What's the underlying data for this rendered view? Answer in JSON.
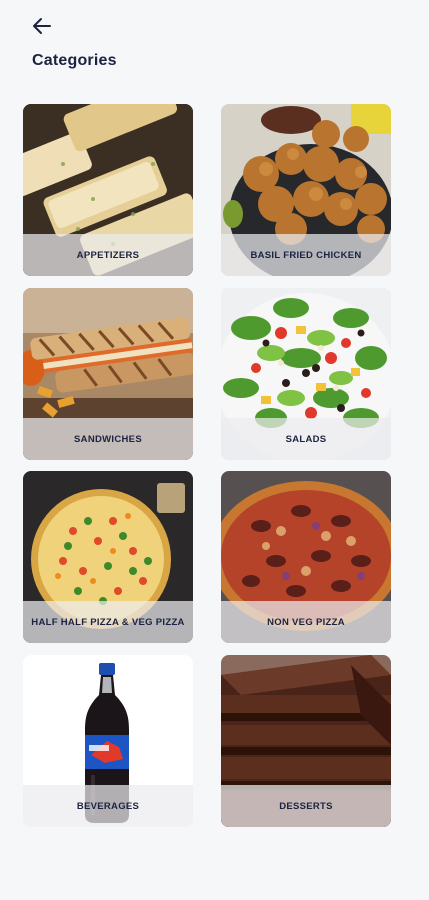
{
  "header": {
    "title": "Categories",
    "back_icon": "arrow-left-icon"
  },
  "categories": [
    {
      "label": "APPETIZERS"
    },
    {
      "label": "BASIL FRIED CHICKEN"
    },
    {
      "label": "SANDWICHES"
    },
    {
      "label": "SALADS"
    },
    {
      "label": "HALF HALF PIZZA & VEG PIZZA"
    },
    {
      "label": "NON VEG PIZZA"
    },
    {
      "label": "BEVERAGES"
    },
    {
      "label": "DESSERTS"
    }
  ],
  "colors": {
    "background": "#f6f7f9",
    "text": "#1c2340",
    "label_bar": "rgba(235,235,238,0.72)"
  }
}
